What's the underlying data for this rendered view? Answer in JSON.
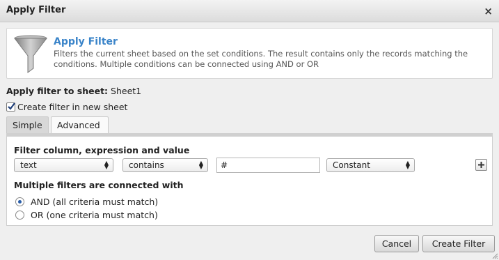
{
  "dialog": {
    "title": "Apply Filter",
    "close_label": "×"
  },
  "info": {
    "title": "Apply Filter",
    "description": "Filters the current sheet based on the set conditions. The result contains only the records matching the conditions. Multiple conditions can be connected using AND or OR",
    "icon": "funnel-icon"
  },
  "sheet": {
    "label": "Apply filter to sheet:",
    "value": "Sheet1"
  },
  "new_sheet": {
    "label": "Create filter in new sheet",
    "checked": true
  },
  "tabs": [
    {
      "label": "Simple",
      "active": true
    },
    {
      "label": "Advanced",
      "active": false
    }
  ],
  "filter": {
    "heading": "Filter column, expression and value",
    "column": "text",
    "expression": "contains",
    "value": "#",
    "value_type": "Constant",
    "add_icon": "plus-icon"
  },
  "connector": {
    "heading": "Multiple filters are connected with",
    "options": [
      {
        "label": "AND (all criteria must match)",
        "selected": true
      },
      {
        "label": "OR (one criteria must match)",
        "selected": false
      }
    ]
  },
  "buttons": {
    "cancel": "Cancel",
    "create": "Create Filter"
  },
  "colors": {
    "accent": "#3a84c9",
    "radio_selected": "#2a5ea8"
  }
}
